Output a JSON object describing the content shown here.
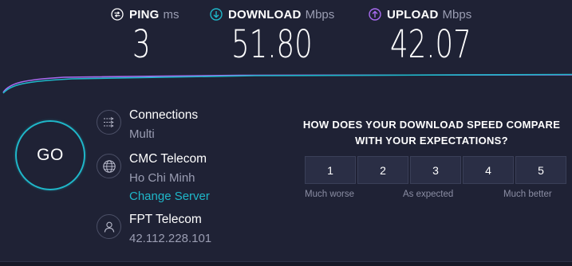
{
  "metrics": {
    "ping": {
      "label": "PING",
      "unit": "ms",
      "value": "3",
      "icon": "ping-gauge-icon",
      "color": "#9a9db2"
    },
    "download": {
      "label": "DOWNLOAD",
      "unit": "Mbps",
      "value": "51.80",
      "icon": "download-arrow-icon",
      "color": "#1fb7c9"
    },
    "upload": {
      "label": "UPLOAD",
      "unit": "Mbps",
      "value": "42.07",
      "icon": "upload-arrow-icon",
      "color": "#a86bf0"
    }
  },
  "go_button": {
    "label": "GO"
  },
  "connections": {
    "title": "Connections",
    "value": "Multi",
    "icon": "connections-icon"
  },
  "server": {
    "name": "CMC Telecom",
    "location": "Ho Chi Minh",
    "change_link": "Change Server",
    "icon": "globe-icon"
  },
  "client": {
    "isp": "FPT Telecom",
    "ip": "42.112.228.101",
    "icon": "user-icon"
  },
  "survey": {
    "question": "HOW DOES YOUR DOWNLOAD SPEED COMPARE WITH YOUR EXPECTATIONS?",
    "options": [
      "1",
      "2",
      "3",
      "4",
      "5"
    ],
    "label_low": "Much worse",
    "label_mid": "As expected",
    "label_high": "Much better"
  },
  "colors": {
    "accent": "#1fb7c9",
    "upload": "#a86bf0",
    "background": "#1f2235"
  }
}
